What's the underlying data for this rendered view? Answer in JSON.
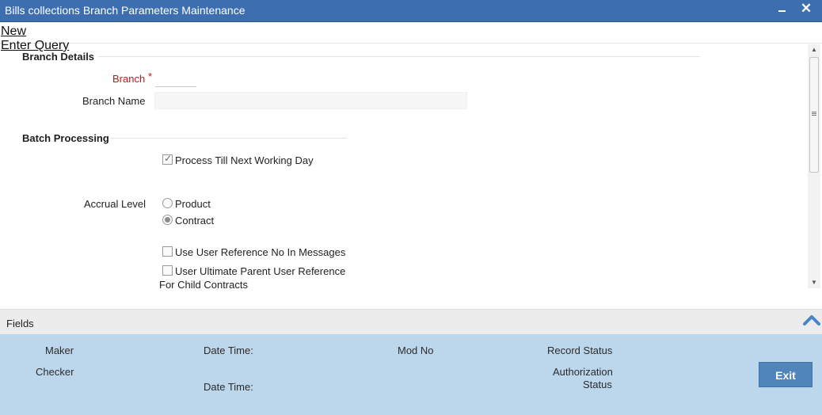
{
  "window": {
    "title": "Bills collections Branch Parameters Maintenance",
    "minimize_icon": "minimize-icon",
    "close_icon": "close-icon",
    "close_glyph": "✕"
  },
  "toolbar": {
    "new_label": "New",
    "enter_query_label": "Enter Query"
  },
  "branch_details": {
    "title": "Branch Details",
    "branch_label": "Branch",
    "required_marker": "*",
    "branch_value": "",
    "branch_name_label": "Branch Name",
    "branch_name_value": ""
  },
  "batch_processing": {
    "title": "Batch Processing",
    "process_till_next_working_day": {
      "label": "Process Till Next Working Day",
      "checked": true
    },
    "accrual_level": {
      "label": "Accrual Level",
      "options": [
        {
          "label": "Product",
          "selected": false
        },
        {
          "label": "Contract",
          "selected": true
        }
      ]
    },
    "use_user_reference": {
      "label": "Use User Reference No In Messages",
      "checked": false
    },
    "user_ultimate_parent": {
      "label_line1": "User Ultimate Parent User Reference",
      "label_line2": "For Child Contracts",
      "checked": false
    }
  },
  "fields_bar": {
    "label": "Fields",
    "toggle_icon": "chevron-up-icon"
  },
  "audit": {
    "maker_label": "Maker",
    "checker_label": "Checker",
    "date_time_label": "Date Time:",
    "mod_no_label": "Mod No",
    "record_status_label": "Record Status",
    "authorization_label_line1": "Authorization",
    "authorization_label_line2": "Status",
    "exit_label": "Exit"
  },
  "colors": {
    "title_bar": "#3d6fb0",
    "required": "#c2151d",
    "audit_panel": "#bcd6ec",
    "exit_button": "#4f85bb"
  }
}
